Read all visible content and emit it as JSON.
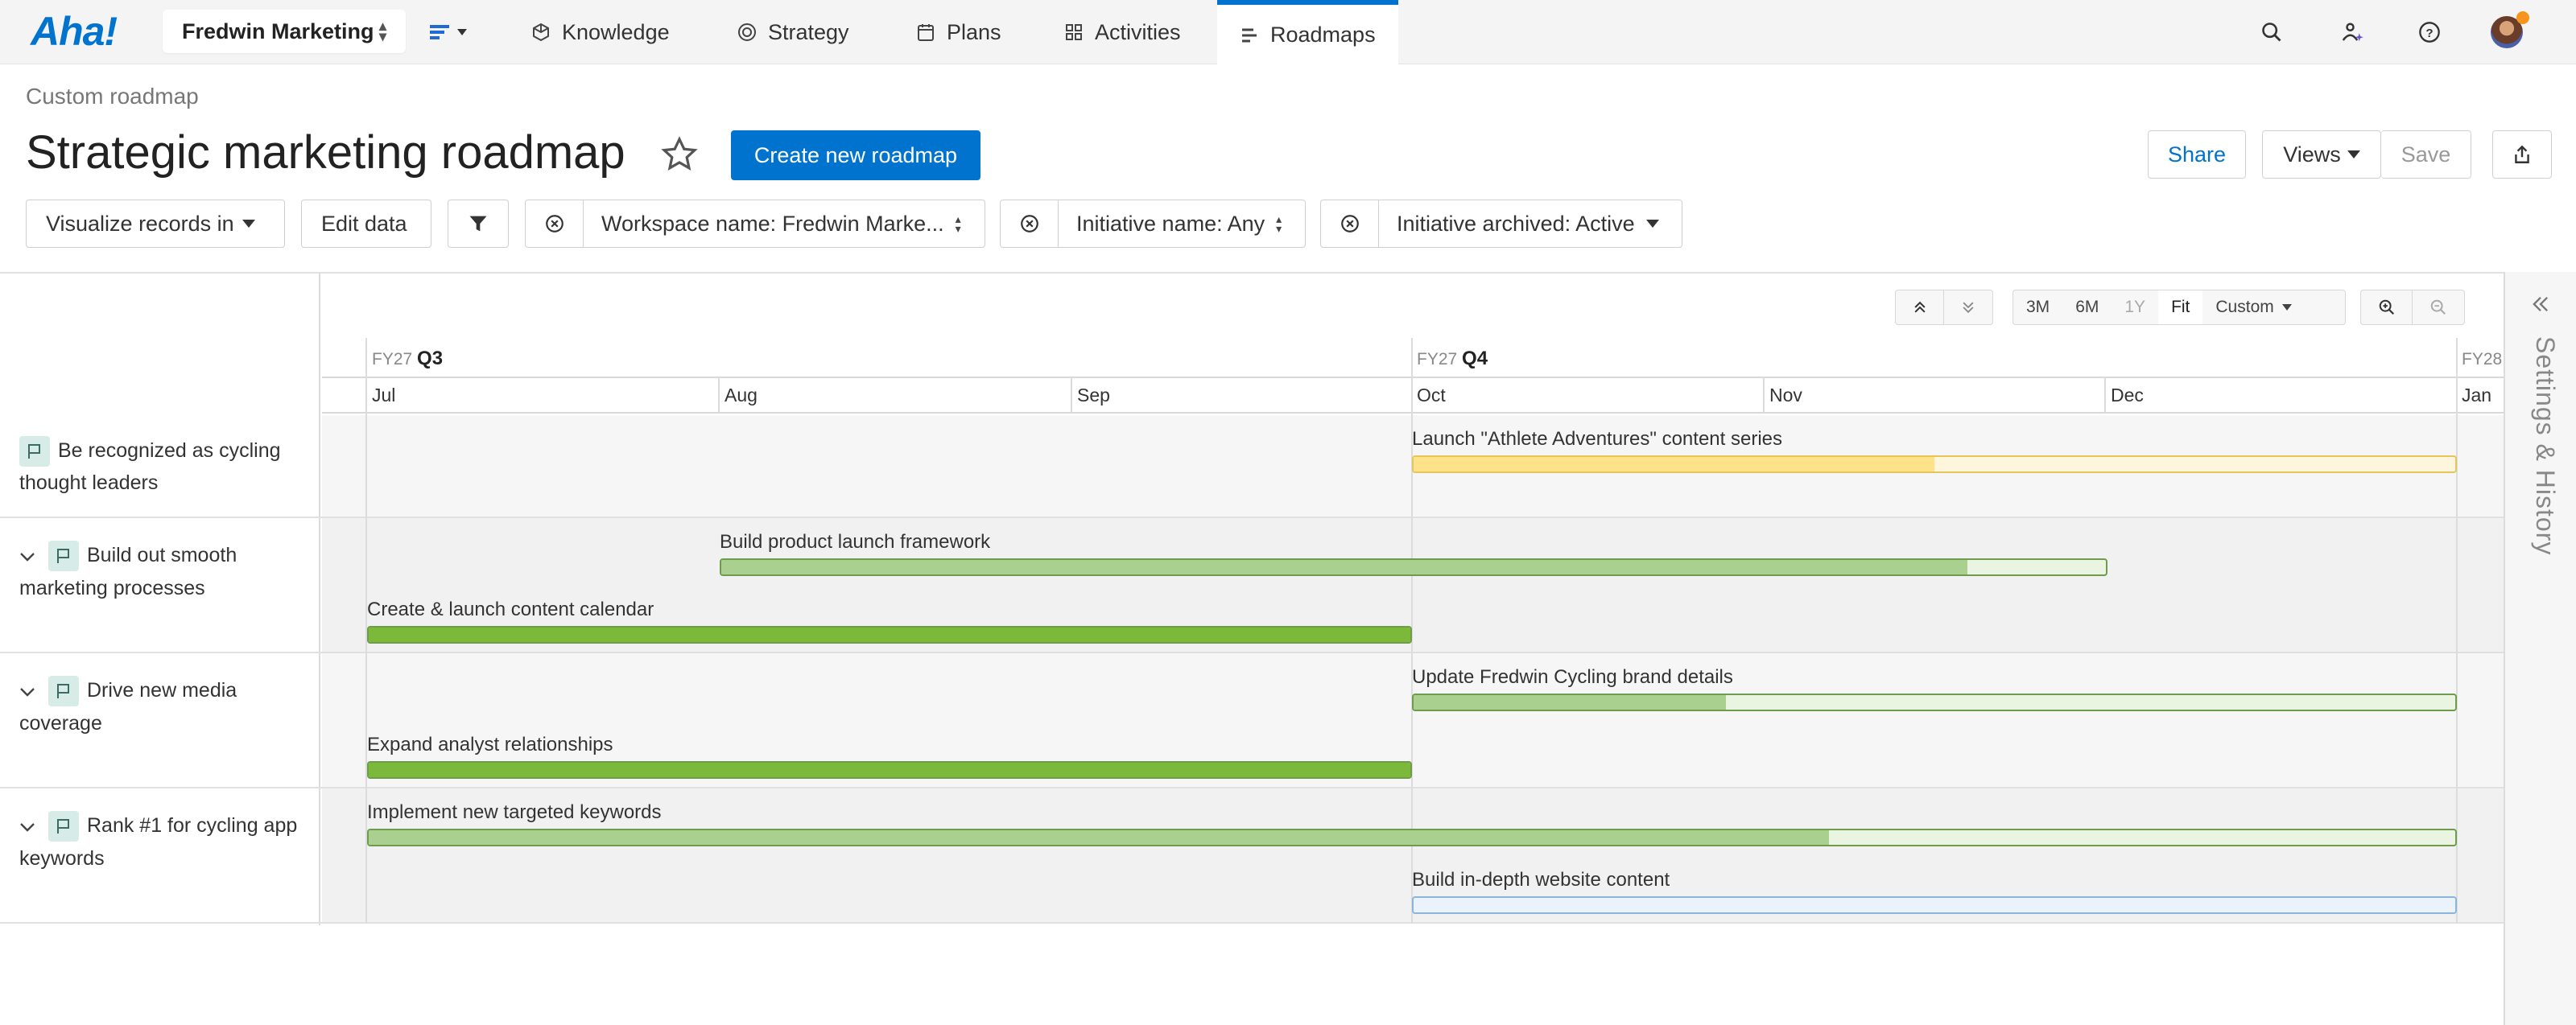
{
  "nav": {
    "logo": "Aha!",
    "workspace": "Fredwin Marketing",
    "items": [
      {
        "label": "Knowledge",
        "icon": "cube-icon"
      },
      {
        "label": "Strategy",
        "icon": "target-icon"
      },
      {
        "label": "Plans",
        "icon": "calendar-icon"
      },
      {
        "label": "Activities",
        "icon": "grid-icon"
      },
      {
        "label": "Roadmaps",
        "icon": "roadmap-icon",
        "active": true
      }
    ]
  },
  "header": {
    "breadcrumb": "Custom roadmap",
    "title": "Strategic marketing roadmap",
    "create_label": "Create new roadmap",
    "share_label": "Share",
    "views_label": "Views",
    "save_label": "Save"
  },
  "filters": {
    "visualize_label": "Visualize records in",
    "edit_label": "Edit data",
    "workspace_filter": "Workspace name: Fredwin Marke...",
    "initiative_filter": "Initiative name: Any",
    "archived_filter": "Initiative archived: Active"
  },
  "toolbar": {
    "zoom_options": [
      "3M",
      "6M",
      "1Y",
      "Fit"
    ],
    "selected_zoom": "Fit",
    "custom_label": "Custom"
  },
  "timeline": {
    "quarters": [
      {
        "fy": "FY27",
        "q": "Q3"
      },
      {
        "fy": "FY27",
        "q": "Q4"
      },
      {
        "fy": "FY28",
        "q": ""
      }
    ],
    "months": [
      "Jul",
      "Aug",
      "Sep",
      "Oct",
      "Nov",
      "Dec",
      "Jan"
    ]
  },
  "goals": [
    {
      "label": "Be recognized as cycling thought leaders",
      "collapsible": false
    },
    {
      "label": "Build out smooth marketing processes",
      "collapsible": true
    },
    {
      "label": "Drive new media coverage",
      "collapsible": true
    },
    {
      "label": "Rank #1 for cycling app keywords",
      "collapsible": true
    }
  ],
  "initiatives": [
    {
      "label": "Launch \"Athlete Adventures\" content series",
      "progress": 0.5,
      "color": "#fde28a",
      "track": "#fdf5dc"
    },
    {
      "label": "Build product launch framework",
      "progress": 0.9,
      "color": "#a9d08e",
      "track": "#eaf5e1"
    },
    {
      "label": "Create & launch content calendar",
      "progress": 1.0,
      "color": "#7cb83a",
      "track": "#eaf5e1"
    },
    {
      "label": "Update Fredwin Cycling brand details",
      "progress": 0.3,
      "color": "#a9d08e",
      "track": "#eaf5e1"
    },
    {
      "label": "Expand analyst relationships",
      "progress": 1.0,
      "color": "#7cb83a",
      "track": "#eaf5e1"
    },
    {
      "label": "Implement new targeted keywords",
      "progress": 0.7,
      "color": "#a9d08e",
      "track": "#eaf5e1"
    },
    {
      "label": "Build in-depth website content",
      "progress": 0.0,
      "color": "#cfe3f7",
      "track": "#eaf3fb"
    }
  ],
  "side_panel": {
    "label": "Settings & History"
  }
}
